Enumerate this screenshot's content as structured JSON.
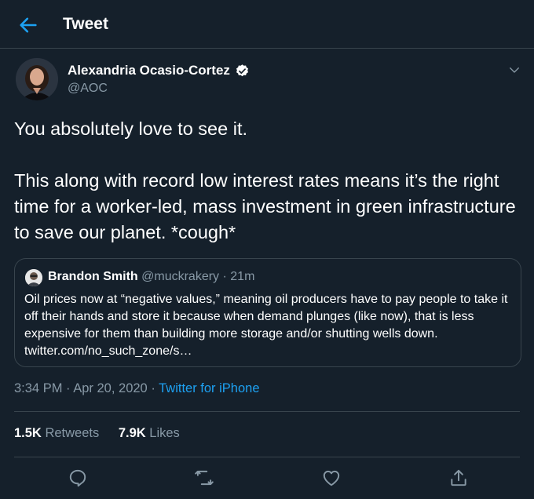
{
  "header": {
    "title": "Tweet",
    "back_icon": "arrow-left-icon"
  },
  "author": {
    "name": "Alexandria Ocasio-Cortez",
    "handle": "@AOC",
    "verified": true
  },
  "tweet": {
    "paragraph1": "You absolutely love to see it.",
    "paragraph2": "This along with record low interest rates means it’s the right time for a worker-led, mass investment in green infrastructure to save our planet. *cough*"
  },
  "quote": {
    "name": "Brandon Smith",
    "handle": "@muckrakery",
    "dot": "·",
    "time": "21m",
    "text": "Oil prices now at “negative values,” meaning oil producers have to pay people to take it off their hands and store it because when demand plunges (like now), that is less expensive for them than building more storage and/or shutting wells down. twitter.com/no_such_zone/s…"
  },
  "meta": {
    "time": "3:34 PM",
    "dot1": "·",
    "date": "Apr 20, 2020",
    "dot2": "·",
    "source": "Twitter for iPhone"
  },
  "stats": {
    "retweets_count": "1.5K",
    "retweets_label": "Retweets",
    "likes_count": "7.9K",
    "likes_label": "Likes"
  },
  "actions": [
    "reply-icon",
    "retweet-icon",
    "like-icon",
    "share-icon"
  ],
  "colors": {
    "background": "#15202b",
    "accent": "#1da1f2",
    "secondary_text": "#8899a6",
    "border": "#38444d"
  }
}
